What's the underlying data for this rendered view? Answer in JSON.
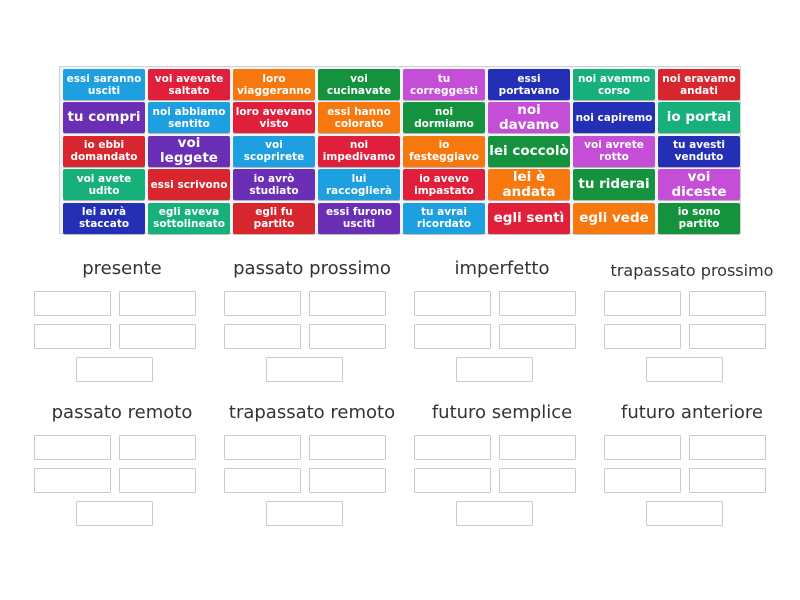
{
  "tiles": [
    {
      "text": "essi saranno\nusciti",
      "color": "#1e9fe0"
    },
    {
      "text": "voi avevate\nsaltato",
      "color": "#e0203a"
    },
    {
      "text": "loro\nviaggeranno",
      "color": "#f6780f"
    },
    {
      "text": "voi\ncucinavate",
      "color": "#14923e"
    },
    {
      "text": "tu\ncorreggesti",
      "color": "#c44fd6"
    },
    {
      "text": "essi\nportavano",
      "color": "#2330b5"
    },
    {
      "text": "noi avemmo\ncorso",
      "color": "#18b07a"
    },
    {
      "text": "noi eravamo\nandati",
      "color": "#d8262f"
    },
    {
      "text": "tu compri",
      "color": "#6a2fb5",
      "big": true
    },
    {
      "text": "noi abbiamo\nsentito",
      "color": "#1e9fe0"
    },
    {
      "text": "loro avevano\nvisto",
      "color": "#e0203a"
    },
    {
      "text": "essi hanno\ncolorato",
      "color": "#f6780f"
    },
    {
      "text": "noi\ndormiamo",
      "color": "#14923e"
    },
    {
      "text": "noi davamo",
      "color": "#c44fd6",
      "big": true
    },
    {
      "text": "noi capiremo",
      "color": "#2330b5"
    },
    {
      "text": "io portai",
      "color": "#18b07a",
      "big": true
    },
    {
      "text": "io ebbi\ndomandato",
      "color": "#d8262f"
    },
    {
      "text": "voi leggete",
      "color": "#6a2fb5",
      "big": true
    },
    {
      "text": "voi\nscoprirete",
      "color": "#1e9fe0"
    },
    {
      "text": "noi\nimpedivamo",
      "color": "#e0203a"
    },
    {
      "text": "io\nfesteggiavo",
      "color": "#f6780f"
    },
    {
      "text": "lei coccolò",
      "color": "#14923e",
      "big": true
    },
    {
      "text": "voi avrete\nrotto",
      "color": "#c44fd6"
    },
    {
      "text": "tu avesti\nvenduto",
      "color": "#2330b5"
    },
    {
      "text": "voi avete\nudito",
      "color": "#18b07a"
    },
    {
      "text": "essi scrivono",
      "color": "#d8262f"
    },
    {
      "text": "io avrò\nstudiato",
      "color": "#6a2fb5"
    },
    {
      "text": "lui\nraccoglierà",
      "color": "#1e9fe0"
    },
    {
      "text": "io avevo\nimpastato",
      "color": "#e0203a"
    },
    {
      "text": "lei è andata",
      "color": "#f6780f",
      "big": true
    },
    {
      "text": "tu riderai",
      "color": "#14923e",
      "big": true
    },
    {
      "text": "voi diceste",
      "color": "#c44fd6",
      "big": true
    },
    {
      "text": "lei avrà\nstaccato",
      "color": "#2330b5"
    },
    {
      "text": "egli aveva\nsottolineato",
      "color": "#18b07a"
    },
    {
      "text": "egli fu\npartito",
      "color": "#d8262f"
    },
    {
      "text": "essi furono\nusciti",
      "color": "#6a2fb5"
    },
    {
      "text": "tu avrai\nricordato",
      "color": "#1e9fe0"
    },
    {
      "text": "egli sentì",
      "color": "#e0203a",
      "big": true
    },
    {
      "text": "egli vede",
      "color": "#f6780f",
      "big": true
    },
    {
      "text": "io sono\npartito",
      "color": "#14923e"
    }
  ],
  "categories": [
    {
      "title": "presente"
    },
    {
      "title": "passato prossimo"
    },
    {
      "title": "imperfetto"
    },
    {
      "title": "trapassato prossimo",
      "small": true
    },
    {
      "title": "passato remoto"
    },
    {
      "title": "trapassato remoto"
    },
    {
      "title": "futuro semplice"
    },
    {
      "title": "futuro anteriore"
    }
  ]
}
